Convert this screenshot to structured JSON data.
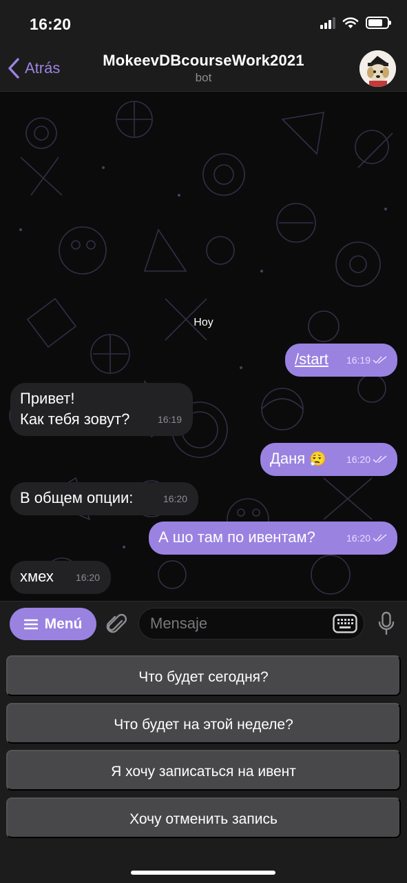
{
  "status_bar": {
    "time": "16:20"
  },
  "header": {
    "back_label": "Atrás",
    "title": "MokeevDBcourseWork2021",
    "subtitle": "bot"
  },
  "chat": {
    "date_label": "Hoy",
    "messages": [
      {
        "direction": "out",
        "text": "/start",
        "time": "16:19",
        "is_command": true,
        "read": true
      },
      {
        "direction": "in",
        "text_line1": "Привет!",
        "text_line2": "Как тебя зовут?",
        "time": "16:19"
      },
      {
        "direction": "out",
        "text": "Даня",
        "emoji": "😮‍💨",
        "time": "16:20",
        "read": true
      },
      {
        "direction": "in",
        "text": "В общем опции:",
        "time": "16:20"
      },
      {
        "direction": "out",
        "text": "А шо там по ивентам?",
        "time": "16:20",
        "read": true
      },
      {
        "direction": "in",
        "text": "хмех",
        "time": "16:20"
      }
    ]
  },
  "input_bar": {
    "menu_label": "Menú",
    "placeholder": "Mensaje"
  },
  "keyboard": {
    "buttons": [
      "Что будет сегодня?",
      "Что будет на этой неделе?",
      "Я хочу записаться на ивент",
      "Хочу отменить запись"
    ]
  },
  "colors": {
    "accent": "#9a82e1",
    "outgoing_bubble": "#9a82e1",
    "incoming_bubble": "#222225",
    "bar_background": "#1c1c1d",
    "keyboard_button": "#48484b"
  },
  "icons": [
    "chevron-left-icon",
    "hamburger-icon",
    "paperclip-icon",
    "keyboard-icon",
    "microphone-icon",
    "double-check-icon",
    "signal-icon",
    "wifi-icon",
    "battery-icon"
  ]
}
